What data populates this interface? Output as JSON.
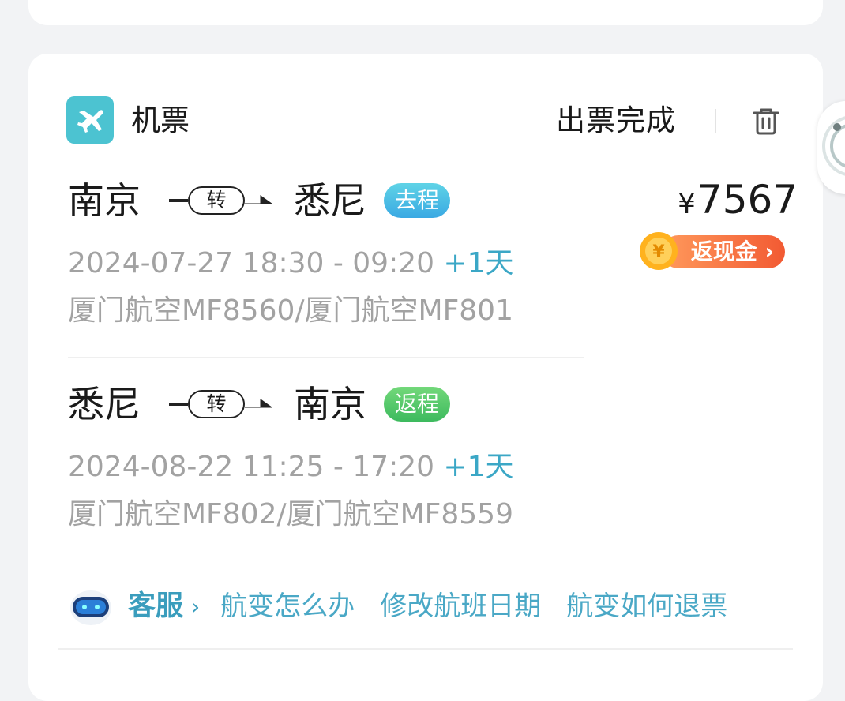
{
  "colors": {
    "teal": "#4cc3d1",
    "link": "#4aa8c6",
    "gray_text": "#a2a2a2",
    "outbound_tag": "#3aa9e3",
    "return_tag": "#3dba5e",
    "cashback": "#f25a33"
  },
  "header": {
    "icon": "airplane-icon",
    "title": "机票",
    "status": "出票完成",
    "delete_icon": "trash-icon"
  },
  "price": {
    "currency": "¥",
    "amount": "7567",
    "cashback_label": "返现金"
  },
  "segments": [
    {
      "from": "南京",
      "connector": "转",
      "to": "悉尼",
      "tag": "去程",
      "time": "2024-07-27 18:30 - 09:20",
      "plus_day": "+1天",
      "flights": "厦门航空MF8560/厦门航空MF801"
    },
    {
      "from": "悉尼",
      "connector": "转",
      "to": "南京",
      "tag": "返程",
      "time": "2024-08-22 11:25 - 17:20",
      "plus_day": "+1天",
      "flights": "厦门航空MF802/厦门航空MF8559"
    }
  ],
  "bottom": {
    "service_label": "客服",
    "chevron": "›",
    "links": [
      "航变怎么办",
      "修改航班日期",
      "航变如何退票"
    ]
  }
}
